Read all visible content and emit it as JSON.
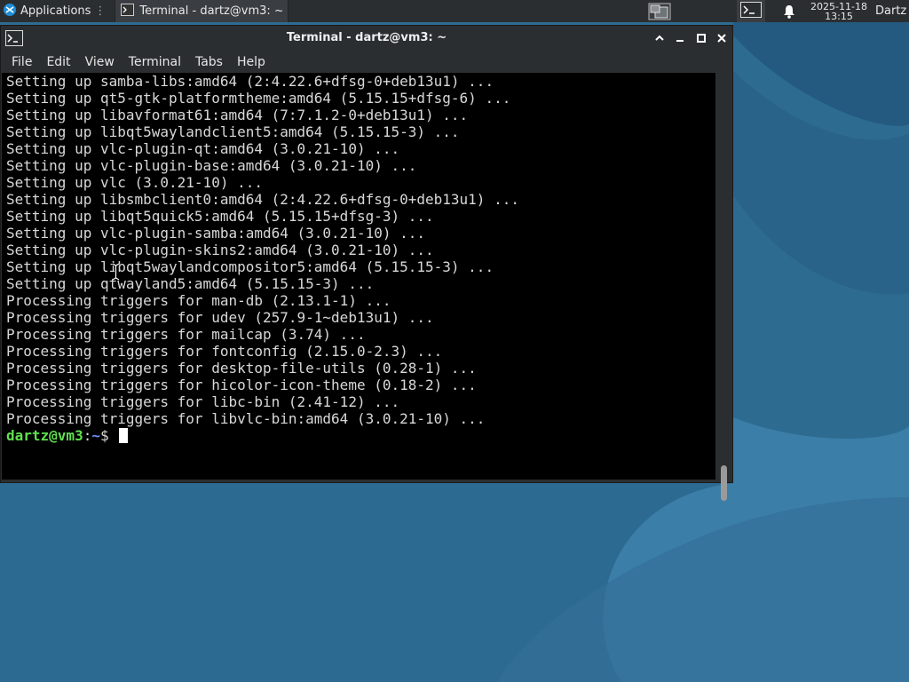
{
  "panel": {
    "applications_label": "Applications",
    "taskbar_item_label": "Terminal - dartz@vm3: ~",
    "clock_date": "2025-11-18",
    "clock_time": "13:15",
    "user_label": "Dartz"
  },
  "window": {
    "title": "Terminal - dartz@vm3: ~"
  },
  "menu": {
    "items": [
      "File",
      "Edit",
      "View",
      "Terminal",
      "Tabs",
      "Help"
    ]
  },
  "terminal": {
    "lines": [
      "Setting up samba-libs:amd64 (2:4.22.6+dfsg-0+deb13u1) ...",
      "Setting up qt5-gtk-platformtheme:amd64 (5.15.15+dfsg-6) ...",
      "Setting up libavformat61:amd64 (7:7.1.2-0+deb13u1) ...",
      "Setting up libqt5waylandclient5:amd64 (5.15.15-3) ...",
      "Setting up vlc-plugin-qt:amd64 (3.0.21-10) ...",
      "Setting up vlc-plugin-base:amd64 (3.0.21-10) ...",
      "Setting up vlc (3.0.21-10) ...",
      "Setting up libsmbclient0:amd64 (2:4.22.6+dfsg-0+deb13u1) ...",
      "Setting up libqt5quick5:amd64 (5.15.15+dfsg-3) ...",
      "Setting up vlc-plugin-samba:amd64 (3.0.21-10) ...",
      "Setting up vlc-plugin-skins2:amd64 (3.0.21-10) ...",
      "Setting up libqt5waylandcompositor5:amd64 (5.15.15-3) ...",
      "Setting up qtwayland5:amd64 (5.15.15-3) ...",
      "Processing triggers for man-db (2.13.1-1) ...",
      "Processing triggers for udev (257.9-1~deb13u1) ...",
      "Processing triggers for mailcap (3.74) ...",
      "Processing triggers for fontconfig (2.15.0-2.3) ...",
      "Processing triggers for desktop-file-utils (0.28-1) ...",
      "Processing triggers for hicolor-icon-theme (0.18-2) ...",
      "Processing triggers for libc-bin (2.41-12) ...",
      "Processing triggers for libvlc-bin:amd64 (3.0.21-10) ..."
    ],
    "prompt_user": "dartz@vm3",
    "prompt_sep": ":",
    "prompt_path": "~",
    "prompt_symbol": "$ "
  },
  "icons": {
    "apps": "xfce-logo-icon",
    "terminal": "terminal-icon",
    "workspace": "workspace-switcher-icon",
    "bell": "bell-icon",
    "mouse_cursor": "text-cursor-icon"
  },
  "colors": {
    "panel_bg": "#2b2e31",
    "terminal_bg": "#000000",
    "terminal_fg": "#d8d8d8",
    "prompt_user": "#5fe04f",
    "prompt_path": "#6b8fff",
    "desktop_blue": "#2f6f96"
  }
}
